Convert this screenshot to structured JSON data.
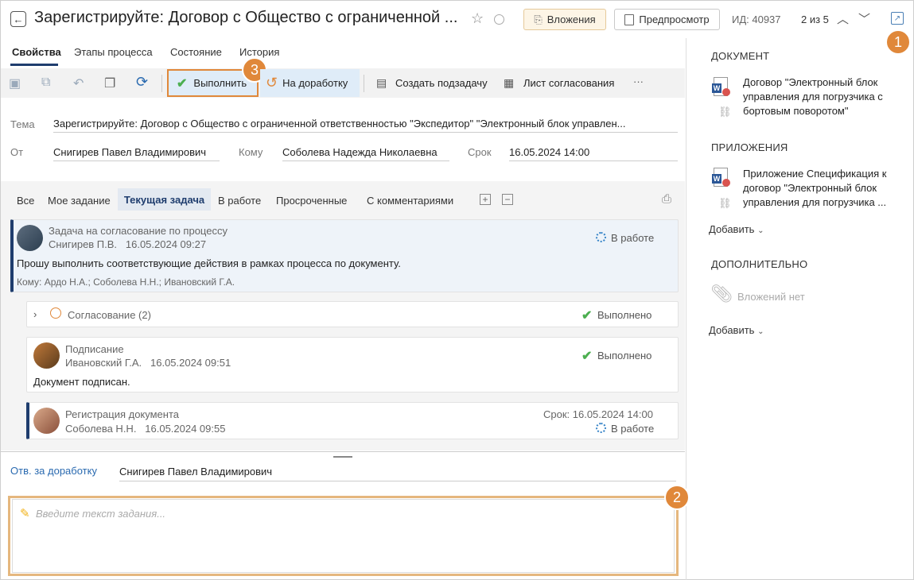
{
  "header": {
    "title": "Зарегистрируйте: Договор с Общество с ограниченной ...",
    "attachments_label": "Вложения",
    "preview_label": "Предпросмотр",
    "id_label": "ИД: 40937",
    "pager": "2 из 5"
  },
  "badges": {
    "b1": "1",
    "b2": "2",
    "b3": "3"
  },
  "tabs": [
    "Свойства",
    "Этапы процесса",
    "Состояние",
    "История"
  ],
  "toolbar": {
    "complete": "Выполнить",
    "rework": "На доработку",
    "subtask": "Создать подзадачу",
    "approval_sheet": "Лист согласования",
    "more": "···"
  },
  "fields": {
    "subject_label": "Тема",
    "subject": "Зарегистрируйте: Договор с Общество с ограниченной ответственностью \"Экспедитор\" \"Электронный блок управлен...",
    "from_label": "От",
    "from": "Снигирев Павел Владимирович",
    "to_label": "Кому",
    "to": "Соболева Надежда Николаевна",
    "due_label": "Срок",
    "due": "16.05.2024 14:00"
  },
  "feed_tabs": [
    "Все",
    "Мое задание",
    "Текущая задача",
    "В работе",
    "Просроченные",
    "С комментариями"
  ],
  "feed": {
    "main": {
      "title": "Задача на согласование по процессу",
      "author": "Снигирев П.В.   16.05.2024 09:27",
      "status": "В работе",
      "text": "Прошу выполнить соответствующие действия в рамках процесса по документу.",
      "recipients": "Кому: Ардо Н.А.; Соболева Н.Н.; Ивановский Г.А."
    },
    "approval": {
      "title": "Согласование (2)",
      "status": "Выполнено"
    },
    "signing": {
      "title": "Подписание",
      "author": "Ивановский Г.А.   16.05.2024 09:51",
      "status": "Выполнено",
      "text": "Документ подписан."
    },
    "registration": {
      "title": "Регистрация документа",
      "author": "Соболева Н.Н.   16.05.2024 09:55",
      "due": "Срок: 16.05.2024 14:00",
      "status": "В работе"
    }
  },
  "bottom": {
    "rework_label": "Отв. за доработку",
    "rework_person": "Снигирев Павел Владимирович",
    "task_placeholder": "Введите текст задания..."
  },
  "right": {
    "document_header": "ДОКУМЕНТ",
    "document_name": "Договор \"Электронный блок управления для погрузчика с бортовым поворотом\"",
    "attachments_header": "ПРИЛОЖЕНИЯ",
    "attachment_name": "Приложение Спецификация к договор \"Электронный блок управления для погрузчика ...",
    "add1": "Добавить",
    "extra_header": "ДОПОЛНИТЕЛЬНО",
    "no_attachments": "Вложений нет",
    "add2": "Добавить"
  },
  "colors": {
    "accent": "#1f3d6e",
    "badge": "#e0883a",
    "highlight_border": "#e5b77e",
    "done": "#4caf50",
    "in_progress": "#3a86c8"
  }
}
